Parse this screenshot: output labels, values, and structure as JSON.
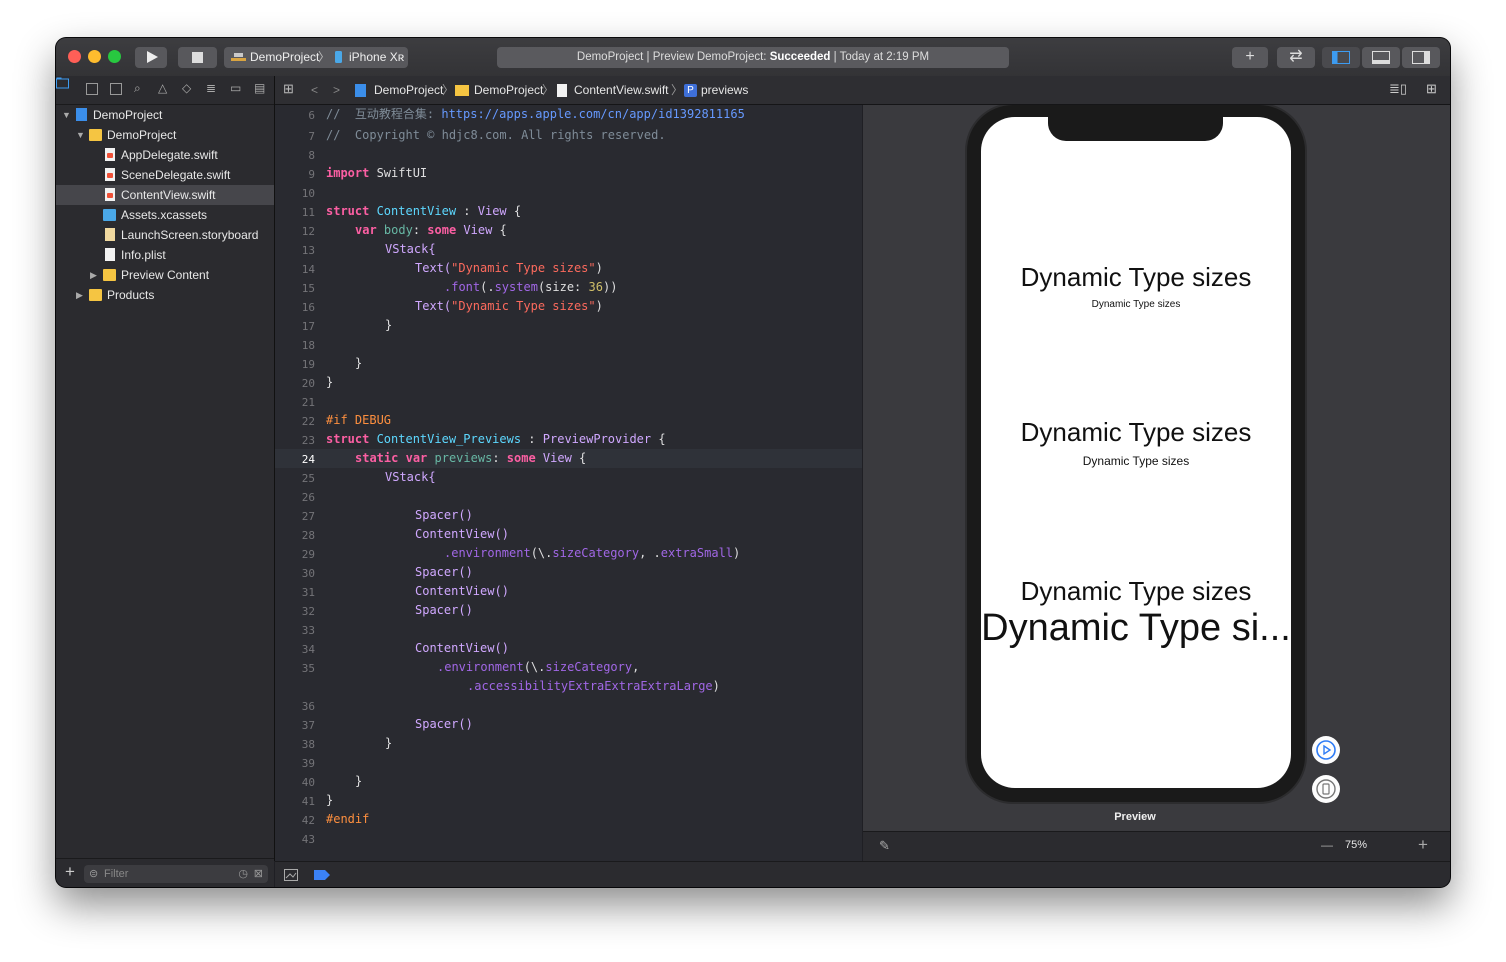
{
  "toolbar": {
    "scheme_name": "DemoProject",
    "scheme_sep": "〉",
    "device_name": "iPhone Xʀ",
    "activity_prefix": "DemoProject | Preview DemoProject: ",
    "activity_status": "Succeeded",
    "activity_suffix": " | Today at 2:19 PM",
    "add_label": "+",
    "swap_label": "⇄"
  },
  "navigator": {
    "items": [
      {
        "label": "DemoProject"
      },
      {
        "label": "DemoProject"
      },
      {
        "label": "AppDelegate.swift"
      },
      {
        "label": "SceneDelegate.swift"
      },
      {
        "label": "ContentView.swift"
      },
      {
        "label": "Assets.xcassets"
      },
      {
        "label": "LaunchScreen.storyboard"
      },
      {
        "label": "Info.plist"
      },
      {
        "label": "Preview Content"
      },
      {
        "label": "Products"
      }
    ],
    "filter_placeholder": "Filter",
    "add_label": "+"
  },
  "jumpbar": {
    "crumbs": [
      "DemoProject",
      "DemoProject",
      "ContentView.swift",
      "previews"
    ],
    "sep": "〉",
    "symbol_badge": "P"
  },
  "editor": {
    "current_line": "24",
    "lines": [
      {
        "n": "6"
      },
      {
        "n": "7"
      },
      {
        "n": "8"
      },
      {
        "n": "9"
      },
      {
        "n": "10"
      },
      {
        "n": "11"
      },
      {
        "n": "12"
      },
      {
        "n": "13"
      },
      {
        "n": "14"
      },
      {
        "n": "15"
      },
      {
        "n": "16"
      },
      {
        "n": "17"
      },
      {
        "n": "18"
      },
      {
        "n": "19"
      },
      {
        "n": "20"
      },
      {
        "n": "21"
      },
      {
        "n": "22"
      },
      {
        "n": "23"
      },
      {
        "n": "24"
      },
      {
        "n": "25"
      },
      {
        "n": "26"
      },
      {
        "n": "27"
      },
      {
        "n": "28"
      },
      {
        "n": "29"
      },
      {
        "n": "30"
      },
      {
        "n": "31"
      },
      {
        "n": "32"
      },
      {
        "n": "33"
      },
      {
        "n": "34"
      },
      {
        "n": "35"
      },
      {
        "n": ""
      },
      {
        "n": "36"
      },
      {
        "n": "37"
      },
      {
        "n": "38"
      },
      {
        "n": "39"
      },
      {
        "n": "40"
      },
      {
        "n": "41"
      },
      {
        "n": "42"
      },
      {
        "n": "43"
      }
    ],
    "code": {
      "c6_a": "//  互动教程合集: ",
      "c6_b": "https://apps.apple.com/cn/app/id1392811165",
      "c7": "//  Copyright © hdjc8.com. All rights reserved.",
      "import_kw": "import",
      "import_mod": " SwiftUI",
      "struct_kw": "struct",
      "cv_name": " ContentView",
      "colon": " : ",
      "view_t": "View",
      "brace_open": " {",
      "var_kw": "var",
      "body_name": " body",
      "colon2": ": ",
      "some_kw": "some",
      "view_t2": " View",
      "vstack": "VStack{",
      "text_fn": "Text(",
      "str1": "\"Dynamic Type sizes\"",
      "paren_close": ")",
      "dot_font": ".font",
      "paren_dot": "(.",
      "system_fn": "system",
      "size_lbl": "(size: ",
      "num36": "36",
      "close2": "))",
      "brace_close": "}",
      "if_debug": "#if DEBUG",
      "cvp_name": " ContentView_Previews",
      "pp_type": "PreviewProvider",
      "static_kw": "static",
      "previews_name": " previews",
      "spacer": "Spacer()",
      "content_view_call": "ContentView()",
      "env": ".environment",
      "env_open": "(\\.",
      "size_cat": "sizeCategory",
      "comma": ", .",
      "extra_small": "extraSmall",
      "comma_only": ",",
      "axxxl": ".accessibilityExtraExtraExtraLarge",
      "endif": "#endif"
    }
  },
  "preview": {
    "texts": [
      "Dynamic Type sizes",
      "Dynamic Type sizes",
      "Dynamic Type sizes",
      "Dynamic Type sizes",
      "Dynamic Type sizes",
      "Dynamic Type si..."
    ],
    "label": "Preview",
    "zoom": "75%",
    "minus": "—",
    "plus": "+"
  }
}
